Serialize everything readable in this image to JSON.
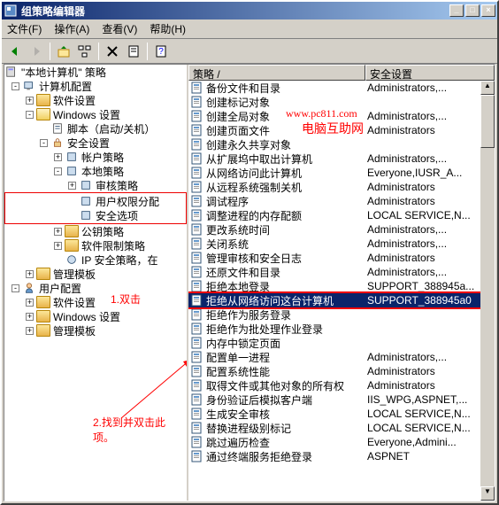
{
  "window": {
    "title": "组策略编辑器"
  },
  "menu": {
    "file": "文件(F)",
    "action": "操作(A)",
    "view": "查看(V)",
    "help": "帮助(H)"
  },
  "tree": {
    "root": "\"本地计算机\" 策略",
    "computer_config": "计算机配置",
    "software_settings": "软件设置",
    "windows_settings": "Windows 设置",
    "scripts": "脚本（启动/关机）",
    "security_settings": "安全设置",
    "account_policies": "帐户策略",
    "local_policies": "本地策略",
    "audit_policy": "审核策略",
    "user_rights": "用户权限分配",
    "security_options": "安全选项",
    "public_key": "公钥策略",
    "software_restrict": "软件限制策略",
    "ip_security": "IP 安全策略，在 ",
    "admin_templates": "管理模板",
    "user_config": "用户配置",
    "software_settings2": "软件设置",
    "windows_settings2": "Windows 设置",
    "admin_templates2": "管理模板"
  },
  "headers": {
    "policy": "策略  /",
    "security": "安全设置"
  },
  "policies": [
    {
      "name": "备份文件和目录",
      "value": "Administrators,..."
    },
    {
      "name": "创建标记对象",
      "value": ""
    },
    {
      "name": "创建全局对象",
      "value": "Administrators,..."
    },
    {
      "name": "创建页面文件",
      "value": "Administrators"
    },
    {
      "name": "创建永久共享对象",
      "value": ""
    },
    {
      "name": "从扩展坞中取出计算机",
      "value": "Administrators,..."
    },
    {
      "name": "从网络访问此计算机",
      "value": "Everyone,IUSR_A..."
    },
    {
      "name": "从远程系统强制关机",
      "value": "Administrators"
    },
    {
      "name": "调试程序",
      "value": "Administrators"
    },
    {
      "name": "调整进程的内存配额",
      "value": "LOCAL SERVICE,N..."
    },
    {
      "name": "更改系统时间",
      "value": "Administrators,..."
    },
    {
      "name": "关闭系统",
      "value": "Administrators,..."
    },
    {
      "name": "管理审核和安全日志",
      "value": "Administrators"
    },
    {
      "name": "还原文件和目录",
      "value": "Administrators,..."
    },
    {
      "name": "拒绝本地登录",
      "value": "SUPPORT_388945a..."
    },
    {
      "name": "拒绝从网络访问这台计算机",
      "value": "SUPPORT_388945a0"
    },
    {
      "name": "拒绝作为服务登录",
      "value": ""
    },
    {
      "name": "拒绝作为批处理作业登录",
      "value": ""
    },
    {
      "name": "内存中锁定页面",
      "value": ""
    },
    {
      "name": "配置单一进程",
      "value": "Administrators,..."
    },
    {
      "name": "配置系统性能",
      "value": "Administrators"
    },
    {
      "name": "取得文件或其他对象的所有权",
      "value": "Administrators"
    },
    {
      "name": "身份验证后模拟客户端",
      "value": "IIS_WPG,ASPNET,..."
    },
    {
      "name": "生成安全审核",
      "value": "LOCAL SERVICE,N..."
    },
    {
      "name": "替换进程级别标记",
      "value": "LOCAL SERVICE,N..."
    },
    {
      "name": "跳过遍历检查",
      "value": "Everyone,Admini..."
    },
    {
      "name": "通过终端服务拒绝登录",
      "value": "ASPNET"
    }
  ],
  "annotations": {
    "wm_url": "www.pc811.com",
    "wm_site": "电脑互助网",
    "step1": "1.双击",
    "step2": "2.找到并双击此项。"
  }
}
